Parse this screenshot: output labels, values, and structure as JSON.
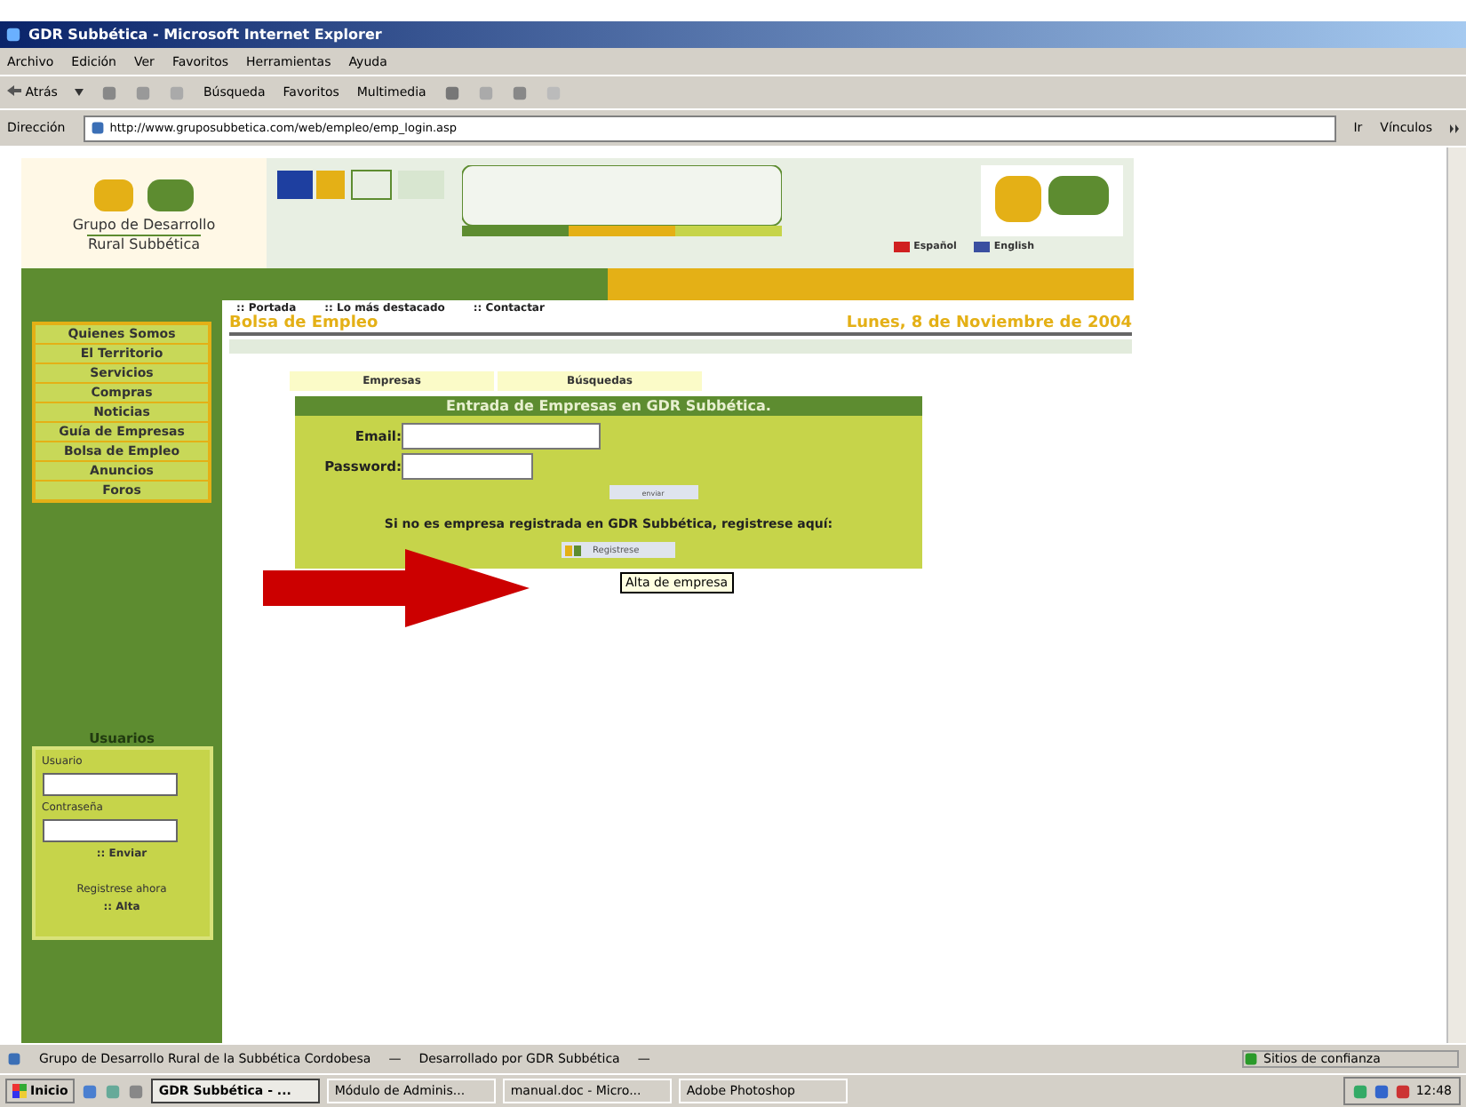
{
  "window": {
    "title": "GDR Subbética - Microsoft Internet Explorer"
  },
  "menu": [
    "Archivo",
    "Edición",
    "Ver",
    "Favoritos",
    "Herramientas",
    "Ayuda"
  ],
  "toolbar": {
    "back": "Atrás",
    "search": "Búsqueda",
    "favorites": "Favoritos",
    "media": "Multimedia"
  },
  "address": {
    "label": "Dirección",
    "url": "http://www.gruposubbetica.com/web/empleo/emp_login.asp",
    "go": "Ir",
    "links": "Vínculos"
  },
  "site": {
    "logo_line_1": "Grupo de Desarrollo",
    "logo_line_2": "Rural Subbética",
    "languages": [
      "Español",
      "English"
    ],
    "nav": [
      ":: Portada",
      ":: Lo más destacado",
      ":: Contactar"
    ],
    "section": "Bolsa de Empleo",
    "date": "Lunes, 8 de Noviembre de 2004",
    "sidebar": [
      "Quienes Somos",
      "El Territorio",
      "Servicios",
      "Compras",
      "Noticias",
      "Guía de Empresas",
      "Bolsa de Empleo",
      "Anuncios",
      "Foros"
    ],
    "subtabs": [
      "Empresas",
      "Búsquedas"
    ],
    "login": {
      "title": "Entrada de Empresas en GDR Subbética.",
      "email_label": "Email:",
      "password_label": "Password:",
      "submit": "enviar",
      "register_text": "Si no es empresa registrada en GDR Subbética, registrese aquí:",
      "register_button": "Registrese",
      "tooltip": "Alta de empresa"
    },
    "users": {
      "title": "Usuarios",
      "user_label": "Usuario",
      "password_label": "Contraseña",
      "send": ":: Enviar",
      "register_text": "Registrese ahora",
      "register_link": ":: Alta"
    }
  },
  "status_bar": [
    "Grupo de Desarrollo Rural de la Subbética Cordobesa",
    "—",
    "Desarrollado por GDR Subbética",
    "—",
    "Sitios de confianza"
  ],
  "taskbar": {
    "start": "Inicio",
    "tasks": [
      {
        "label": "GDR Subbética - ...",
        "selected": true
      },
      {
        "label": "Módulo de Adminis...",
        "selected": false
      },
      {
        "label": "manual.doc - Micro...",
        "selected": false
      },
      {
        "label": "Adobe Photoshop",
        "selected": false
      }
    ],
    "clock": "12:48"
  }
}
